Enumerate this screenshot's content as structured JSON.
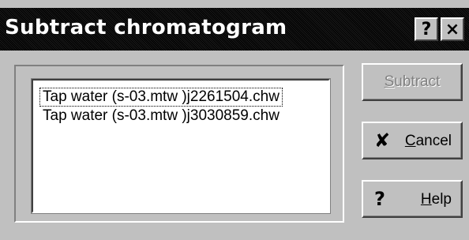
{
  "window": {
    "title": "Subtract chromatogram",
    "help_button": "?",
    "close_button": "×"
  },
  "list": {
    "items": [
      "Tap water (s-03.mtw  )j2261504.chw",
      "Tap water (s-03.mtw  )j3030859.chw"
    ],
    "selected_index": 0
  },
  "buttons": {
    "subtract": {
      "mnemonic": "S",
      "rest": "ubtract",
      "enabled": false
    },
    "cancel": {
      "icon": "x-mark-icon",
      "glyph": "✘",
      "mnemonic": "C",
      "rest": "ancel"
    },
    "help": {
      "icon": "question-icon",
      "glyph": "?",
      "mnemonic": "H",
      "rest": "elp"
    }
  },
  "colors": {
    "face": "#c0c0c0",
    "titlebar": "#000000",
    "disabled_text": "#808080"
  }
}
